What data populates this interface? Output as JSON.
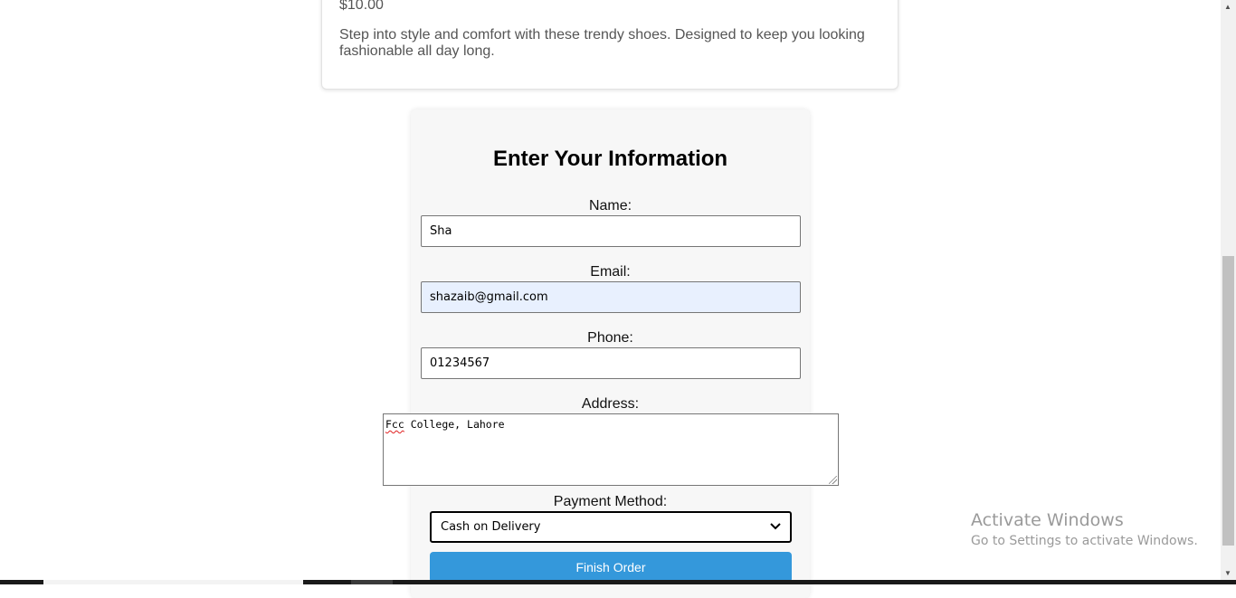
{
  "product": {
    "price": "$10.00",
    "description": "Step into style and comfort with these trendy shoes. Designed to keep you looking fashionable all day long."
  },
  "form": {
    "title": "Enter Your Information",
    "name_label": "Name:",
    "name_value": "Sha",
    "email_label": "Email:",
    "email_value": "shazaib@gmail.com",
    "phone_label": "Phone:",
    "phone_value": "01234567",
    "address_label": "Address:",
    "address_misspelled": "Fcc",
    "address_rest": " College, Lahore",
    "payment_label": "Payment Method:",
    "payment_selected": "Cash on Delivery",
    "submit_label": "Finish Order"
  },
  "watermark": {
    "title": "Activate Windows",
    "subtitle": "Go to Settings to activate Windows."
  },
  "colors": {
    "button": "#3498db",
    "autofill_bg": "#e8f0fe",
    "form_bg": "#f7f7f7"
  }
}
